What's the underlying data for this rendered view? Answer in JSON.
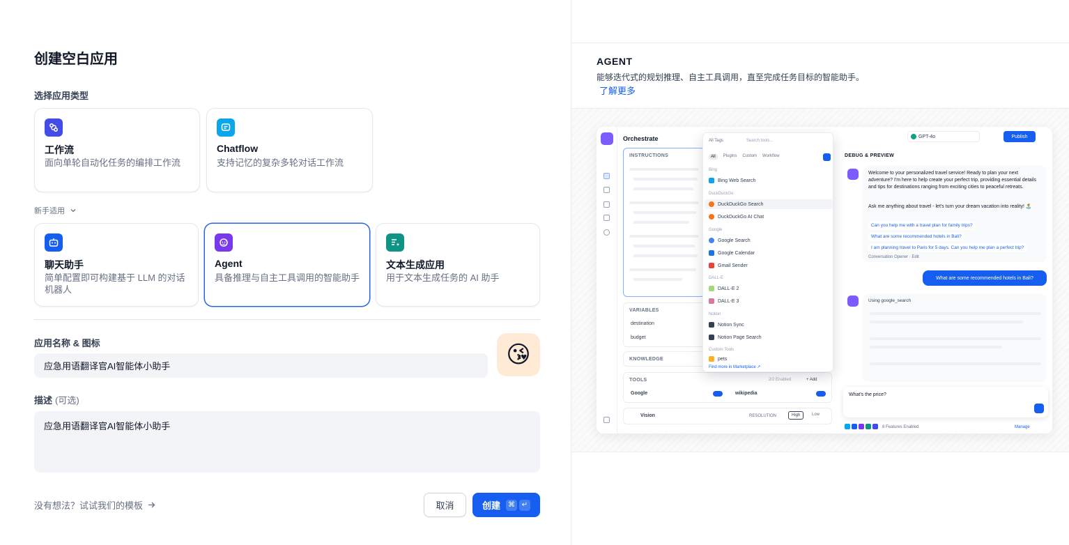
{
  "page": {
    "title": "创建空白应用",
    "select_type_label": "选择应用类型",
    "beginner_label": "新手适用"
  },
  "app_types": [
    {
      "name": "工作流",
      "desc": "面向单轮自动化任务的编排工作流",
      "color": "#444ce7"
    },
    {
      "name": "Chatflow",
      "desc": "支持记忆的复杂多轮对话工作流",
      "color": "#0ba5ec"
    }
  ],
  "beginner_types": [
    {
      "name": "聊天助手",
      "desc": "简单配置即可构建基于 LLM 的对话机器人",
      "color": "#155eef"
    },
    {
      "name": "Agent",
      "desc": "具备推理与自主工具调用的智能助手",
      "color": "#7839ee",
      "selected": true
    },
    {
      "name": "文本生成应用",
      "desc": "用于文本生成任务的 AI 助手",
      "color": "#0e9384"
    }
  ],
  "form": {
    "name_label": "应用名称 & 图标",
    "name_value": "应急用语翻译官AI智能体小助手",
    "emoji": "😘",
    "emoji_bg": "#ffead5",
    "desc_label": "描述",
    "desc_optional": "(可选)",
    "desc_value": "应急用语翻译官AI智能体小助手"
  },
  "footer": {
    "template_link": "没有想法？试试我们的模板",
    "cancel": "取消",
    "create": "创建",
    "kbd_cmd": "⌘",
    "kbd_enter": "↵"
  },
  "preview": {
    "title": "AGENT",
    "desc": "能够迭代式的规划推理、自主工具调用，直至完成任务目标的智能助手。",
    "learn_more": "了解更多",
    "mock": {
      "orchestrate": "Orchestrate",
      "instructions": "INSTRUCTIONS",
      "variables": "VARIABLES",
      "var1": "destination",
      "var2": "budget",
      "knowledge": "KNOWLEDGE",
      "tools": "TOOLS",
      "tools_enabled": "2/2 Enabled",
      "add": "+ Add",
      "tool1": "Google",
      "tool2": "wikipedia",
      "vision": "Vision",
      "resolution": "RESOLUTION",
      "high": "High",
      "low": "Low",
      "all_tags": "All Tags",
      "search_tools": "Search tools...",
      "tabs": [
        "All",
        "Plugins",
        "Custom",
        "Workflow"
      ],
      "groups": [
        {
          "label": "Bing",
          "items": [
            "Bing Web Search"
          ]
        },
        {
          "label": "DuckDuckGo",
          "items": [
            "DuckDuckGo Search",
            "DuckDuckGo AI Chat"
          ]
        },
        {
          "label": "Google",
          "items": [
            "Google Search",
            "Google Calendar",
            "Gmail Sender"
          ]
        },
        {
          "label": "DALL-E",
          "items": [
            "DALL-E 2",
            "DALL-E 3"
          ]
        },
        {
          "label": "Notion",
          "items": [
            "Notion Sync",
            "Notion Page Search"
          ]
        },
        {
          "label": "Custom Tools",
          "items": [
            "pets"
          ]
        }
      ],
      "marketplace": "Find more in Marketplace ↗",
      "model": "GPT-4o",
      "publish": "Publish",
      "debug": "DEBUG & PREVIEW",
      "welcome": "Welcome to your personalized travel service! Ready to plan your next adventure? I'm here to help create your perfect trip, providing essential details and tips for destinations ranging from exciting cities to peaceful retreats.",
      "ask": "Ask me anything about travel - let's turn your dream vacation into reality! 🏝️",
      "suggestions": [
        "Can you help me with a travel plan for family trips?",
        "What are some recommended hotels in Bali?",
        "I am planning travel to Paris for 5 days. Can you help me plan a perfect trip?"
      ],
      "opener": "Conversation Opener · Edit",
      "user_msg": "What are some recommended hotels in Bali?",
      "using": "Using google_search",
      "input_text": "What's the price?",
      "features": "8 Features Enabled",
      "manage": "Manage"
    }
  }
}
